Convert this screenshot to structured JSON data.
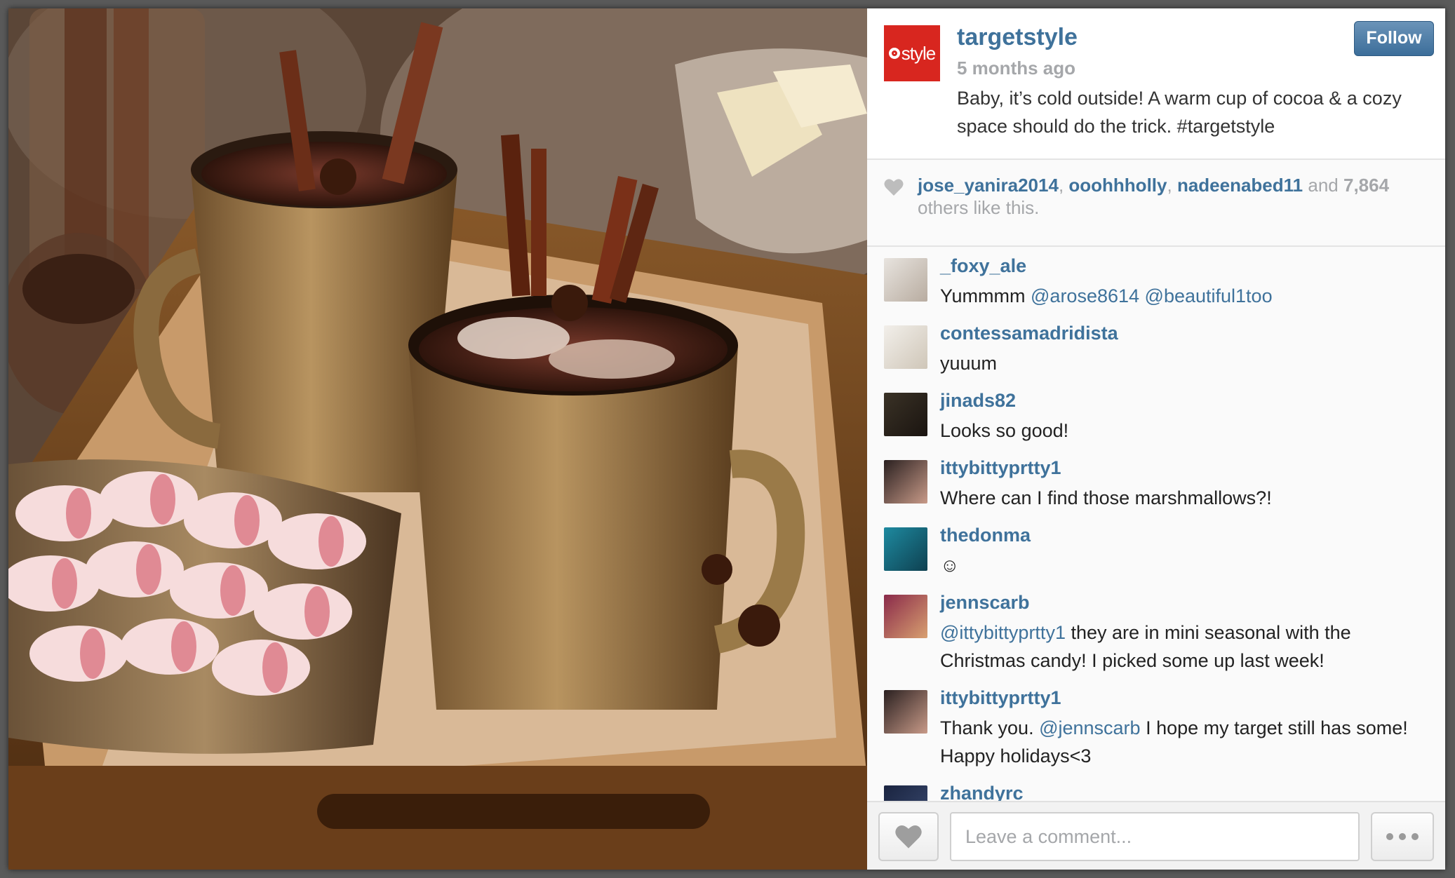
{
  "post": {
    "username": "targetstyle",
    "avatar_text": "style",
    "time_ago": "5 months ago",
    "caption": "Baby, it’s cold outside! A warm cup of cocoa & a cozy space should do the trick. #targetstyle",
    "follow_label": "Follow"
  },
  "likes": {
    "users": [
      "jose_yanira2014",
      "ooohhholly",
      "nadeenabed11"
    ],
    "and_text": "and",
    "count": "7,864",
    "suffix": "others like this."
  },
  "comments": [
    {
      "user": "_foxy_ale",
      "parts": [
        {
          "t": "Yummmm "
        },
        {
          "m": "@arose8614"
        },
        {
          "t": " "
        },
        {
          "m": "@beautiful1too"
        }
      ]
    },
    {
      "user": "contessamadridista",
      "parts": [
        {
          "t": "yuuum"
        }
      ]
    },
    {
      "user": "jinads82",
      "parts": [
        {
          "t": "Looks so good!"
        }
      ]
    },
    {
      "user": "ittybittyprtty1",
      "parts": [
        {
          "t": "Where can I find those marshmallows?!"
        }
      ]
    },
    {
      "user": "thedonma",
      "parts": [
        {
          "t": "☺"
        }
      ]
    },
    {
      "user": "jennscarb",
      "parts": [
        {
          "m": "@ittybittyprtty1"
        },
        {
          "t": " they are in mini seasonal with the Christmas candy! I picked some up last week!"
        }
      ]
    },
    {
      "user": "ittybittyprtty1",
      "parts": [
        {
          "t": "Thank you. "
        },
        {
          "m": "@jennscarb"
        },
        {
          "t": " I hope my target still has some! Happy holidays<3"
        }
      ]
    },
    {
      "user": "zhandyrc",
      "parts": []
    }
  ],
  "footer": {
    "comment_placeholder": "Leave a comment..."
  },
  "colors": {
    "link": "#3f729b",
    "muted": "#a5a7aa",
    "brand": "#d8261f"
  }
}
